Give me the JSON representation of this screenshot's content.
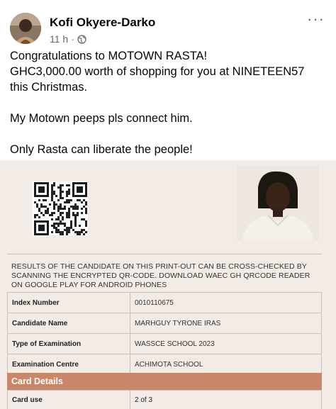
{
  "author": {
    "name": "Kofi Okyere-Darko",
    "time": "11 h",
    "separator": "·"
  },
  "post": {
    "lines": [
      "Congratulations to MOTOWN RASTA!",
      "GHC3,000.00 worth of shopping for you at NINETEEN57",
      "this Christmas.",
      "My Motown peeps pls connect him.",
      "Only Rasta can liberate the people!"
    ]
  },
  "document": {
    "notice": "RESULTS OF THE CANDIDATE ON THIS PRINT-OUT CAN BE CROSS-CHECKED BY SCANNING THE ENCRYPTED QR-CODE. DOWNLOAD WAEC GH QRCODE READER ON GOOGLE PLAY FOR ANDROID PHONES",
    "rows": [
      {
        "label": "Index Number",
        "value": "0010110675"
      },
      {
        "label": "Candidate Name",
        "value": "MARHGUY TYRONE IRAS"
      },
      {
        "label": "Type of Examination",
        "value": "WASSCE SCHOOL 2023"
      },
      {
        "label": "Examination Centre",
        "value": "ACHIMOTA SCHOOL"
      }
    ],
    "card_title": "Card Details",
    "card_rows": [
      {
        "label": "Card use",
        "value": "2 of 3"
      }
    ]
  },
  "colors": {
    "band": "#c98769",
    "meta": "#65676b"
  }
}
